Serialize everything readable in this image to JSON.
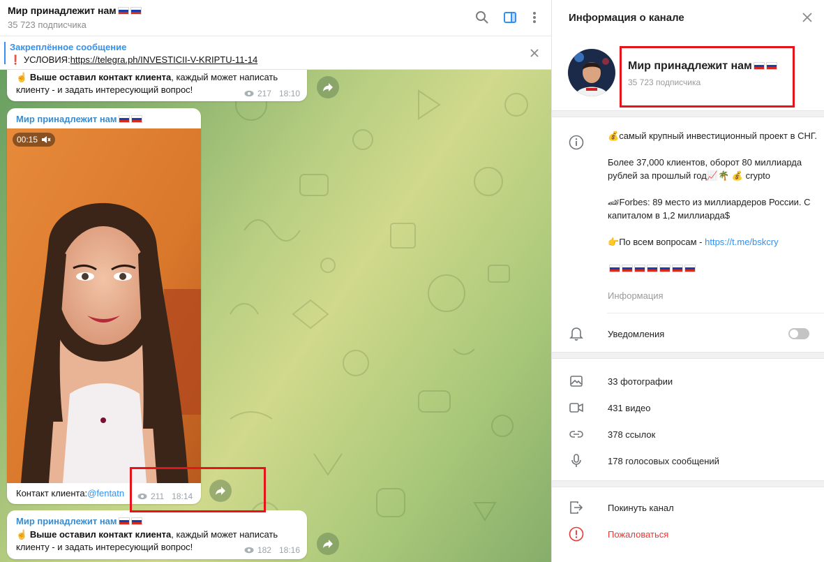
{
  "chat": {
    "title": "Мир принадлежит нам",
    "subtitle": "35 723 подписчика",
    "pinned": {
      "title": "Закреплённое сообщение",
      "prefix": "УСЛОВИЯ:",
      "link": "https://telegra.ph/INVESTICII-V-KRIPTU-11-14"
    },
    "messages": [
      {
        "bold": "Выше оставил контакт клиента",
        "text": ", каждый может написать клиенту - и задать интересующий вопрос!",
        "views": "217",
        "time": "18:10"
      },
      {
        "author": "Мир принадлежит нам",
        "video_duration": "00:15",
        "caption_prefix": "Контакт клиента:",
        "caption_link": "@fentatn",
        "views": "211",
        "time": "18:14"
      },
      {
        "author": "Мир принадлежит нам",
        "bold": "Выше оставил контакт клиента",
        "text": ", каждый может написать клиенту - и задать интересующий вопрос!",
        "views": "182",
        "time": "18:16"
      }
    ]
  },
  "info": {
    "header": "Информация о канале",
    "name": "Мир принадлежит нам",
    "subscribers": "35 723 подписчика",
    "description": {
      "line1": "самый крупный инвестиционный проект в СНГ.",
      "line2a": "Более 37,000 клиентов, оборот 80 миллиарда рублей за прошлый год",
      "line2b": "crypto",
      "line3": "Forbes: 89 место из миллиардеров России. С капиталом в 1,2 миллиарда$",
      "line4": "По всем вопросам - ",
      "line4_link": "https://t.me/bskcry",
      "label": "Информация"
    },
    "notifications": {
      "label": "Уведомления",
      "enabled": false
    },
    "media": [
      {
        "icon": "photo-icon",
        "label": "33 фотографии"
      },
      {
        "icon": "video-icon",
        "label": "431 видео"
      },
      {
        "icon": "link-icon",
        "label": "378 ссылок"
      },
      {
        "icon": "mic-icon",
        "label": "178 голосовых сообщений"
      }
    ],
    "actions": {
      "leave": "Покинуть канал",
      "report": "Пожаловаться"
    }
  },
  "colors": {
    "accent": "#3390ec",
    "highlight_box": "#e5141b",
    "danger": "#e53935"
  }
}
